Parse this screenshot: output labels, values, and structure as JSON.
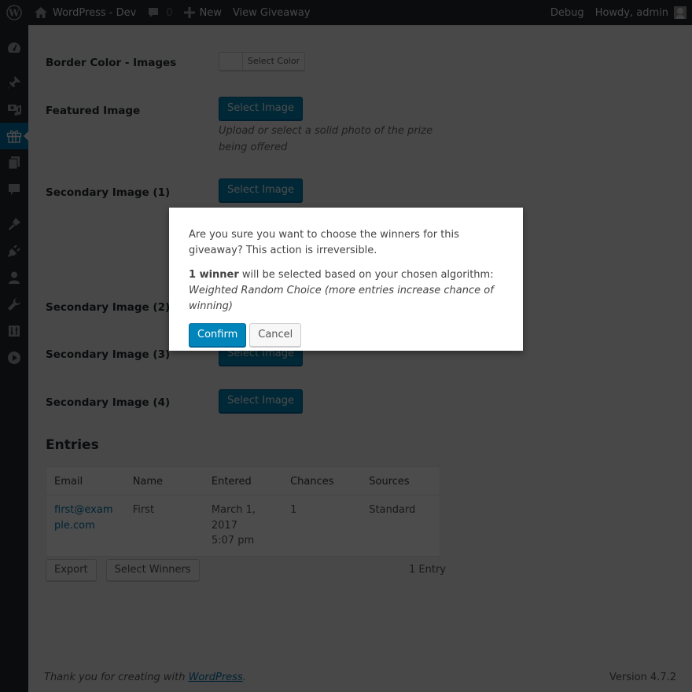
{
  "adminbar": {
    "site_name": "WordPress - Dev",
    "comments_count": "0",
    "new_label": "New",
    "view_label": "View Giveaway",
    "debug_label": "Debug",
    "howdy_label": "Howdy, admin"
  },
  "sidebar": {
    "items": [
      {
        "icon": "dashboard-icon"
      },
      {
        "icon": "pin-icon"
      },
      {
        "icon": "media-icon"
      },
      {
        "icon": "gift-icon",
        "current": true
      },
      {
        "icon": "pages-icon"
      },
      {
        "icon": "comments-icon"
      },
      {
        "icon": "appearance-icon"
      },
      {
        "icon": "plugins-icon"
      },
      {
        "icon": "users-icon"
      },
      {
        "icon": "tools-icon"
      },
      {
        "icon": "settings-icon"
      },
      {
        "icon": "play-icon"
      }
    ]
  },
  "form": {
    "border_color_label": "Border Color - Images",
    "select_color_label": "Select Color",
    "featured_label": "Featured Image",
    "select_image_label": "Select Image",
    "featured_desc": "Upload or select a solid photo of the prize being offered",
    "secondary_1_label": "Secondary Image (1)",
    "secondary_2_label": "Secondary Image (2)",
    "secondary_3_label": "Secondary Image (3)",
    "secondary_4_label": "Secondary Image (4)"
  },
  "entries": {
    "heading": "Entries",
    "columns": [
      "Email",
      "Name",
      "Entered",
      "Chances",
      "Sources"
    ],
    "rows": [
      {
        "email": "first@example.com",
        "name": "First",
        "entered_1": "March 1,",
        "entered_2": "2017",
        "entered_3": "5:07 pm",
        "chances": "1",
        "sources": "Standard"
      }
    ],
    "export_label": "Export",
    "select_winners_label": "Select Winners",
    "count_label": "1 Entry"
  },
  "footer": {
    "thanks_prefix": "Thank you for creating with ",
    "thanks_link": "WordPress",
    "thanks_suffix": ".",
    "version": "Version 4.7.2"
  },
  "modal": {
    "question": "Are you sure you want to choose the winners for this giveaway? This action is irreversible.",
    "winner_count": "1 winner",
    "winner_text": " will be selected based on your chosen algorithm:",
    "algorithm": "Weighted Random Choice (more entries increase chance of winning)",
    "confirm_label": "Confirm",
    "cancel_label": "Cancel"
  },
  "colors": {
    "primary": "#0085ba",
    "adminbar_bg": "#23282d",
    "link": "#0073aa"
  }
}
